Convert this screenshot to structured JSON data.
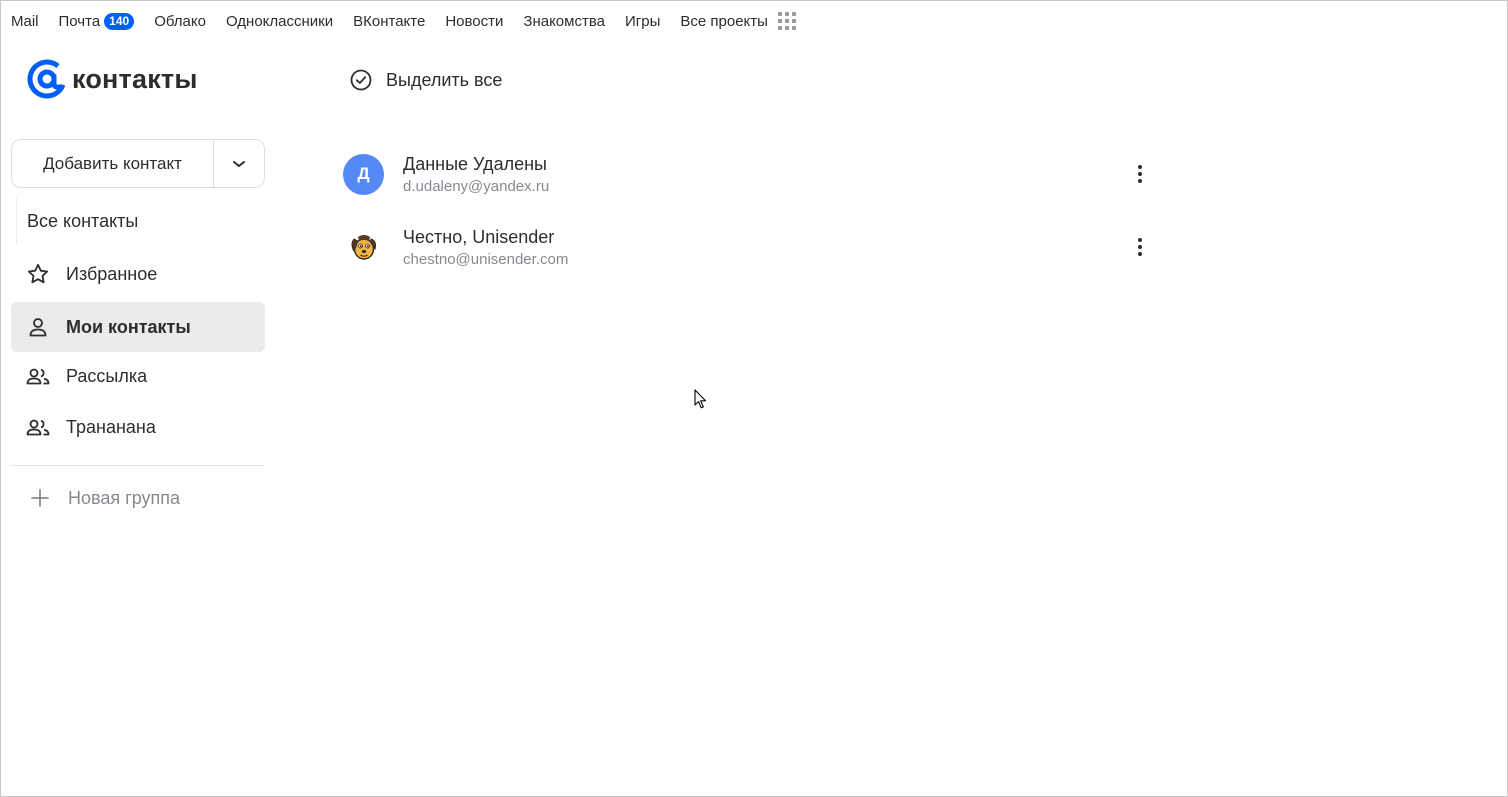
{
  "topbar": {
    "links": [
      {
        "label": "Mail"
      },
      {
        "label": "Почта",
        "badge": "140"
      },
      {
        "label": "Облако"
      },
      {
        "label": "Одноклассники"
      },
      {
        "label": "ВКонтакте"
      },
      {
        "label": "Новости"
      },
      {
        "label": "Знакомства"
      },
      {
        "label": "Игры"
      },
      {
        "label": "Все проекты"
      }
    ],
    "apps_icon": "grid-icon"
  },
  "logo": {
    "text": "контакты",
    "icon": "at-sign-icon",
    "brand_color": "#005ff9"
  },
  "add_contact": {
    "label": "Добавить контакт",
    "arrow_icon": "chevron-down-icon"
  },
  "sidebar": {
    "all_contacts": "Все контакты",
    "items": [
      {
        "label": "Избранное",
        "icon": "star-icon",
        "active": false
      },
      {
        "label": "Мои контакты",
        "icon": "person-icon",
        "active": true
      },
      {
        "label": "Рассылка",
        "icon": "group-icon",
        "active": false
      },
      {
        "label": "Трананана",
        "icon": "group-icon",
        "active": false
      }
    ],
    "new_group": "Новая группа"
  },
  "main": {
    "select_all": "Выделить все",
    "contacts": [
      {
        "name": "Данные Удалены",
        "email": "d.udaleny@yandex.ru",
        "avatar_letter": "Д",
        "avatar_color": "#5589f6"
      },
      {
        "name": "Честно, Unisender",
        "email": "chestno@unisender.com",
        "avatar_icon": "dog-mascot-icon"
      }
    ]
  }
}
